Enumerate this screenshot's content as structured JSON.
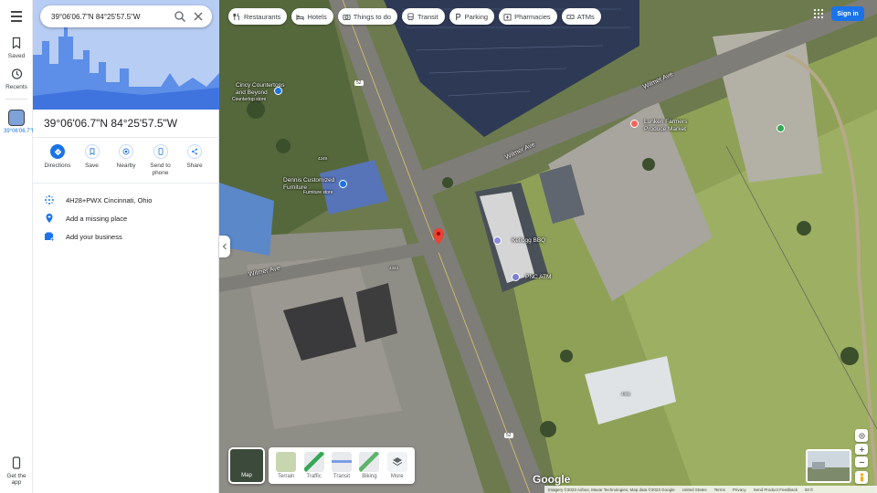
{
  "search": {
    "value": "39°06'06.7\"N 84°25'57.5\"W"
  },
  "rail": {
    "saved": "Saved",
    "recents": "Recents",
    "recent_item": "39°06'06.7\"N",
    "get_app": "Get the app"
  },
  "place": {
    "title": "39°06'06.7\"N 84°25'57.5\"W",
    "actions": [
      {
        "label": "Directions",
        "icon": "directions-icon"
      },
      {
        "label": "Save",
        "icon": "bookmark-icon"
      },
      {
        "label": "Nearby",
        "icon": "nearby-icon"
      },
      {
        "label": "Send to phone",
        "icon": "phone-icon"
      },
      {
        "label": "Share",
        "icon": "share-icon"
      }
    ],
    "info": [
      {
        "text": "4H28+PWX Cincinnati, Ohio",
        "icon": "plus-code-icon"
      },
      {
        "text": "Add a missing place",
        "icon": "add-place-icon"
      },
      {
        "text": "Add your business",
        "icon": "business-icon"
      }
    ]
  },
  "chips": [
    {
      "label": "Restaurants",
      "icon": "restaurant-icon"
    },
    {
      "label": "Hotels",
      "icon": "hotel-icon"
    },
    {
      "label": "Things to do",
      "icon": "camera-icon"
    },
    {
      "label": "Transit",
      "icon": "transit-icon"
    },
    {
      "label": "Parking",
      "icon": "parking-icon"
    },
    {
      "label": "Pharmacies",
      "icon": "pharmacy-icon"
    },
    {
      "label": "ATMs",
      "icon": "atm-icon"
    }
  ],
  "signin": "Sign in",
  "map_labels": {
    "countertops": "Cincy Countertops\nand Beyond",
    "countertops_sub": "Countertop store",
    "dennis": "Dennis Customized\nFurniture",
    "dennis_sub": "Furniture store",
    "lunken": "Lunken Farmers\nProduce Market",
    "kellogg": "Kellogg BBQ",
    "pnc": "PNC ATM",
    "wilmer1": "Wilmer Ave",
    "wilmer2": "Wilmer Ave",
    "wilmer3": "Wilmer Ave",
    "shield1": "52",
    "shield2": "52",
    "num_4249": "4249",
    "num_4343": "4343",
    "num_4401": "4401"
  },
  "layers": {
    "main": "Map",
    "options": [
      "Terrain",
      "Traffic",
      "Transit",
      "Biking",
      "More"
    ]
  },
  "google": "Google",
  "attribution": [
    "Imagery ©2023 Airbus, Maxar Technologies, Map data ©2023 Google",
    "United States",
    "Terms",
    "Privacy",
    "Send Product Feedback",
    "50 ft"
  ],
  "colors": {
    "accent": "#1a73e8",
    "pin": "#ea4335",
    "hero": "#b3c9f2"
  }
}
